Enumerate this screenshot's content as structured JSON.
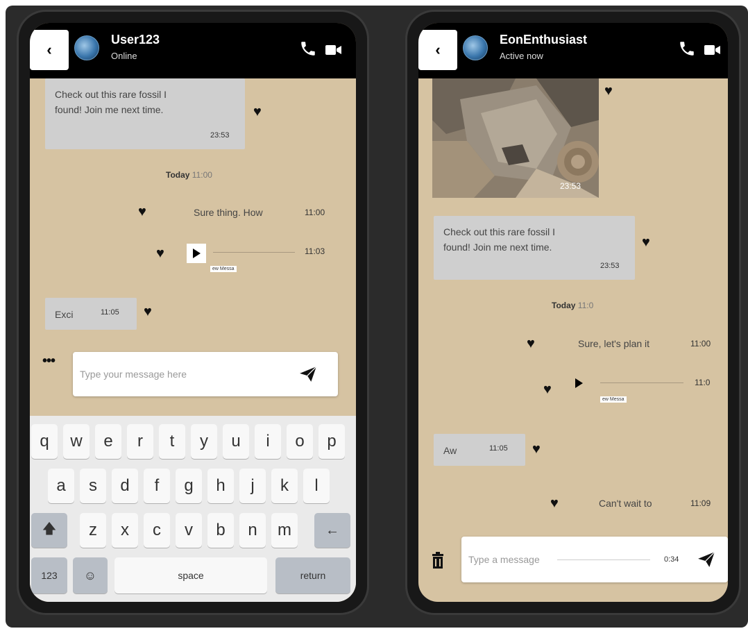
{
  "left": {
    "contact": {
      "name": "User123",
      "status": "Online"
    },
    "messages": {
      "m1": {
        "text_line1": "Check out this rare fossil I",
        "text_line2": "found! Join me next time.",
        "time": "23:53"
      },
      "date": {
        "day": "Today",
        "time": "11:00"
      },
      "m2": {
        "text": "Sure thing. How",
        "time": "11:00"
      },
      "audio": {
        "time": "11:03",
        "label": "ew Messa"
      },
      "m3": {
        "text": "Exci",
        "time": "11:05"
      }
    },
    "input": {
      "placeholder": "Type your message here"
    },
    "keyboard": {
      "row1": [
        "q",
        "w",
        "e",
        "r",
        "t",
        "y",
        "u",
        "i",
        "o",
        "p"
      ],
      "row2": [
        "a",
        "s",
        "d",
        "f",
        "g",
        "h",
        "j",
        "k",
        "l"
      ],
      "row3": [
        "z",
        "x",
        "c",
        "v",
        "b",
        "n",
        "m"
      ],
      "num": "123",
      "space": "space",
      "return": "return"
    }
  },
  "right": {
    "contact": {
      "name": "EonEnthusiast",
      "status": "Active now"
    },
    "messages": {
      "photo_time": "23:53",
      "m1": {
        "text_line1": "Check out this rare fossil I",
        "text_line2": "found! Join me next time.",
        "time": "23:53"
      },
      "date": {
        "day": "Today",
        "time": "11:0"
      },
      "m2": {
        "text": "Sure, let's plan it",
        "time": "11:00"
      },
      "audio": {
        "time": "11:0",
        "label": "ew Messa"
      },
      "m3": {
        "text": "Aw",
        "time": "11:05"
      },
      "m4": {
        "text": "Can't wait to",
        "time": "11:09"
      }
    },
    "input": {
      "placeholder": "Type a message",
      "record_time": "0:34"
    }
  }
}
